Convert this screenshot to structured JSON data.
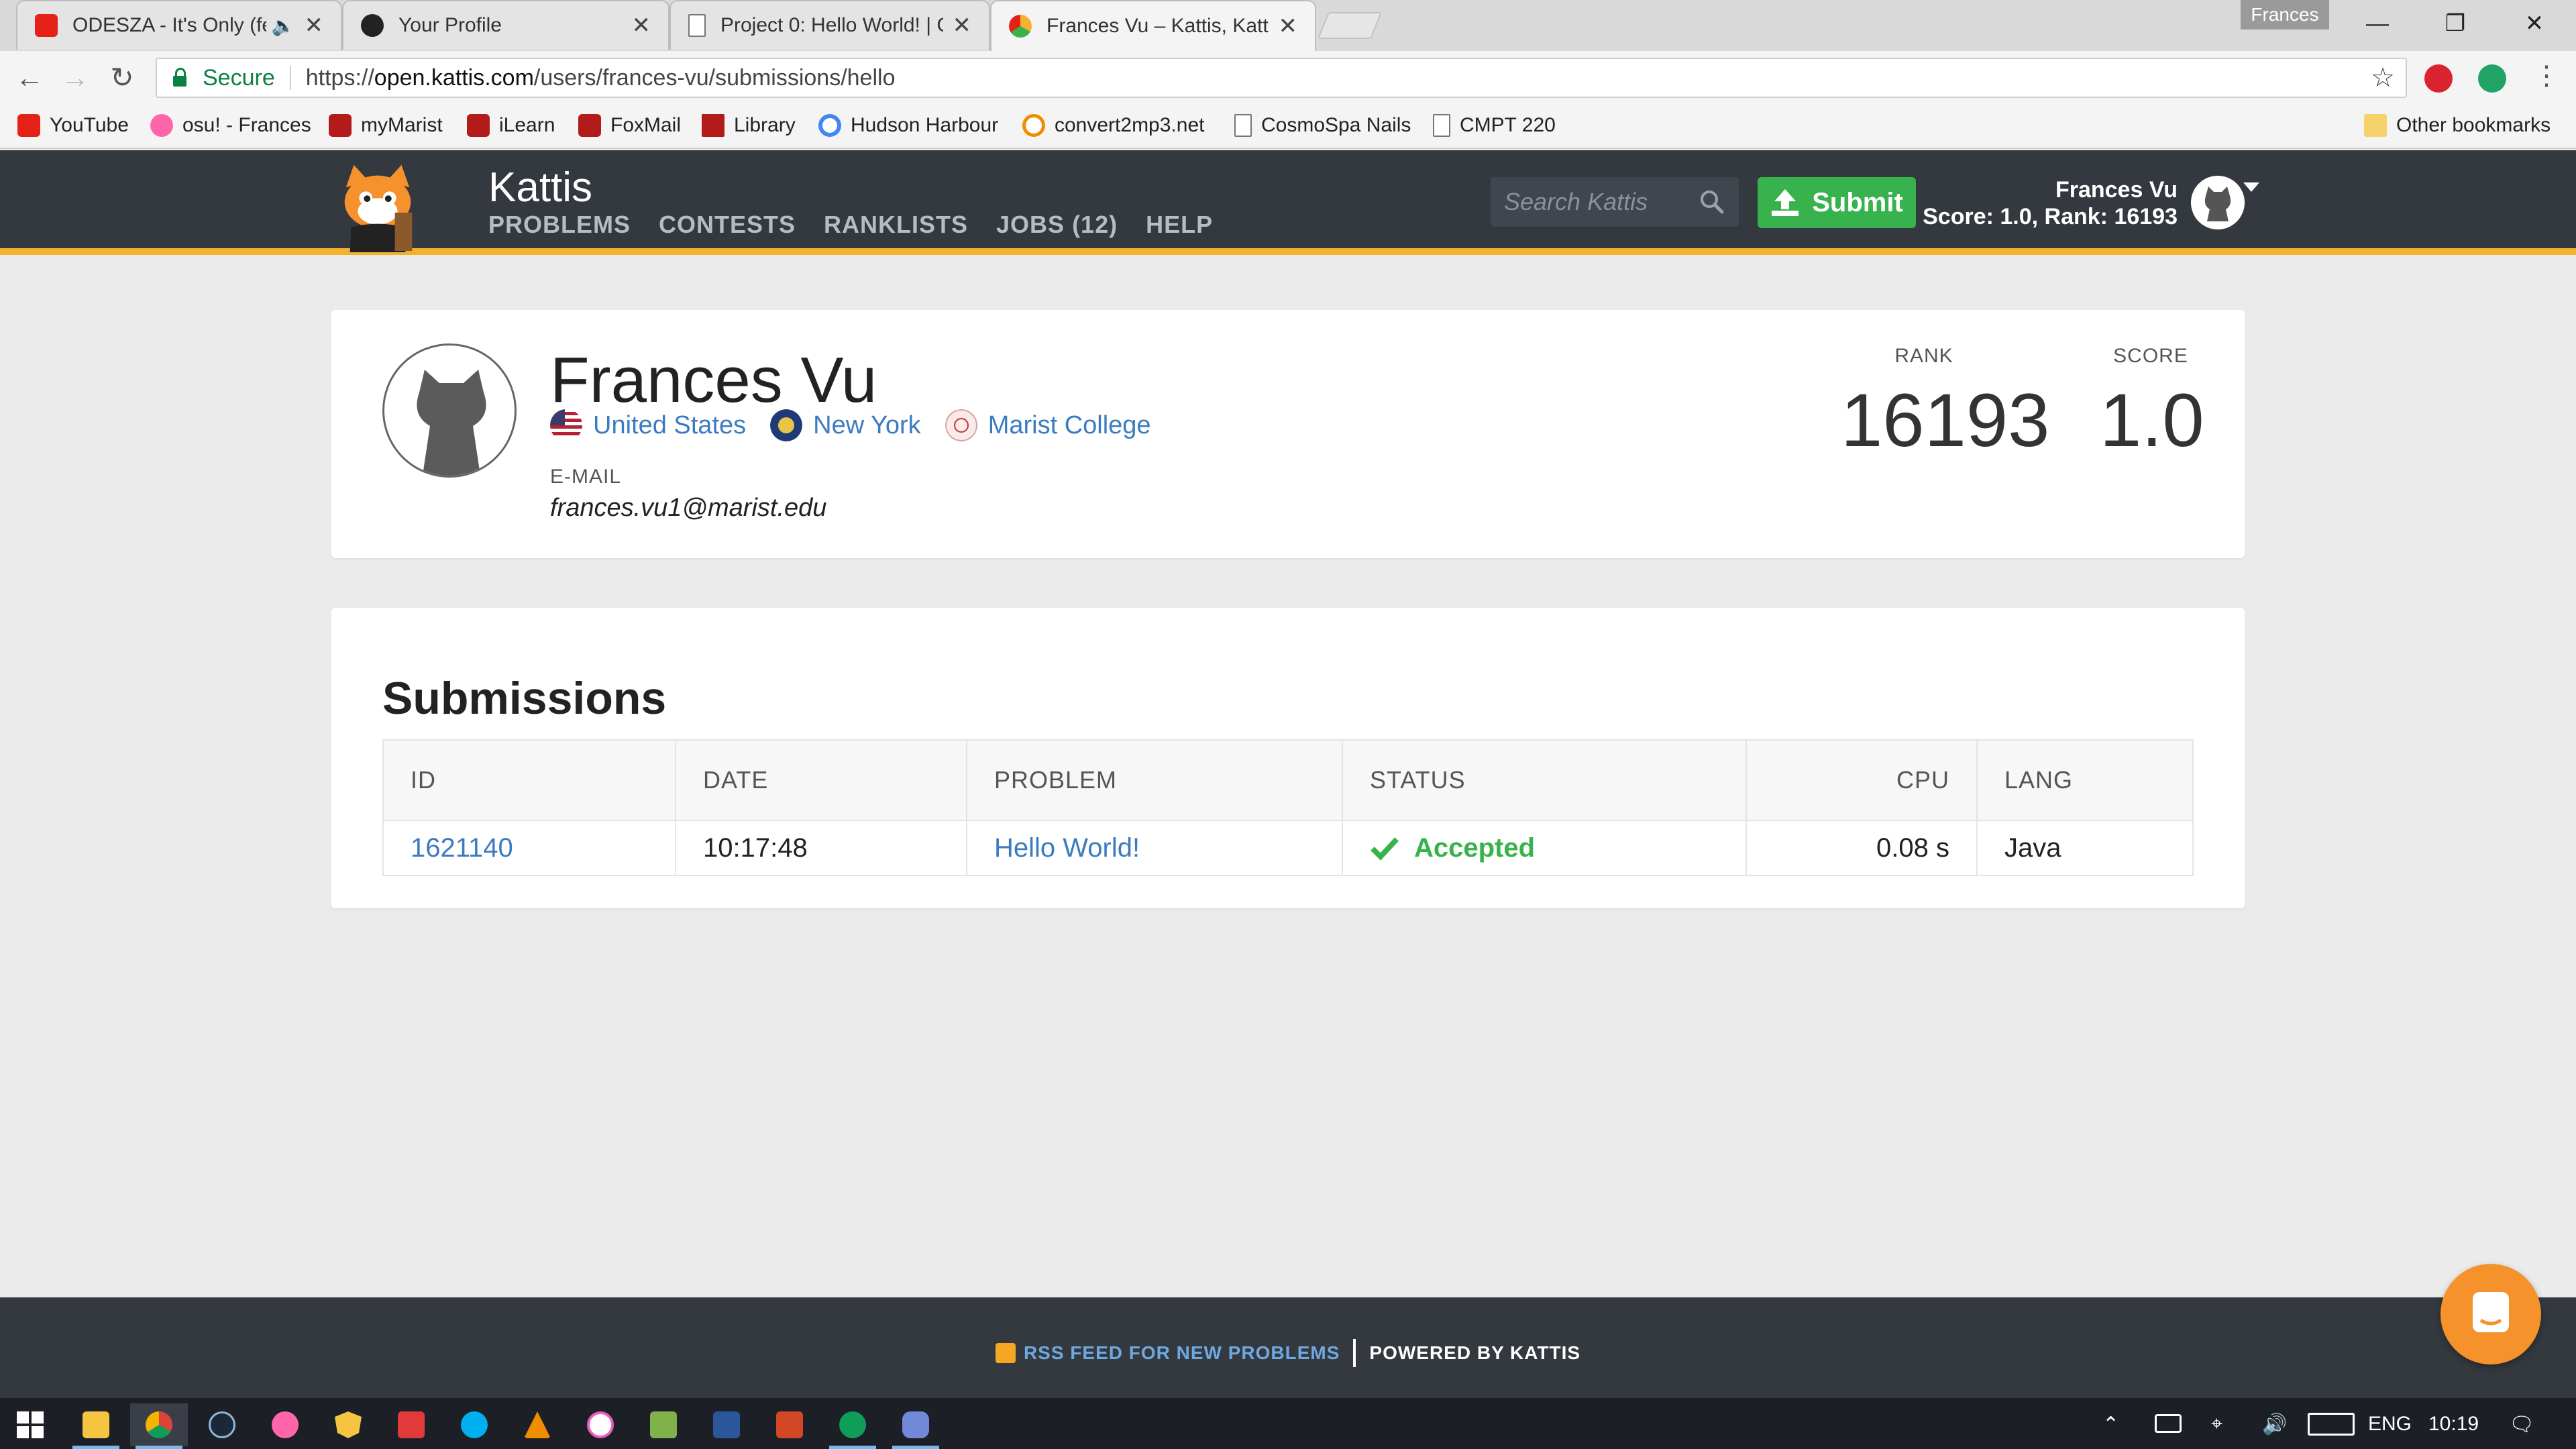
{
  "browser": {
    "tabs": [
      {
        "title": "ODESZA - It's Only (fe",
        "color": "#e62117"
      },
      {
        "title": "Your Profile",
        "color": "#222222"
      },
      {
        "title": "Project 0: Hello World! | C",
        "color": "#ffffff"
      },
      {
        "title": "Frances Vu – Kattis, Katti",
        "color": "#f5b32d"
      }
    ],
    "profile_badge": "Frances",
    "secure_label": "Secure",
    "url_scheme": "https://",
    "url_host": "open.kattis.com",
    "url_path": "/users/frances-vu/submissions/hello",
    "bookmarks": [
      {
        "label": "YouTube",
        "icon": "youtube-icon",
        "color": "#e62117"
      },
      {
        "label": "osu! - Frances",
        "icon": "osu-icon",
        "color": "#ff66aa"
      },
      {
        "label": "myMarist",
        "icon": "marist-fox-icon",
        "color": "#b31b1b"
      },
      {
        "label": "iLearn",
        "icon": "marist-fox-icon",
        "color": "#b31b1b"
      },
      {
        "label": "FoxMail",
        "icon": "marist-fox-icon",
        "color": "#b31b1b"
      },
      {
        "label": "Library",
        "icon": "jac-icon",
        "color": "#b31b1b"
      },
      {
        "label": "Hudson Harbour",
        "icon": "chrome-ring-icon",
        "color": "#4285f4"
      },
      {
        "label": "convert2mp3.net",
        "icon": "convert-icon",
        "color": "#f08c00"
      },
      {
        "label": "CosmoSpa Nails",
        "icon": "page-icon",
        "color": "#ffffff"
      },
      {
        "label": "CMPT 220",
        "icon": "page-icon",
        "color": "#ffffff"
      }
    ],
    "other_bookmarks": "Other bookmarks"
  },
  "kattis": {
    "brand": "Kattis",
    "nav": [
      "PROBLEMS",
      "CONTESTS",
      "RANKLISTS",
      "JOBS (12)",
      "HELP"
    ],
    "search_placeholder": "Search Kattis",
    "submit_label": "Submit",
    "user_name": "Frances Vu",
    "user_score_line": "Score: 1.0, Rank: 16193",
    "accent": "#f5b32d"
  },
  "profile": {
    "name": "Frances Vu",
    "country": "United States",
    "state": "New York",
    "college": "Marist College",
    "email_label": "E-MAIL",
    "email": "frances.vu1@marist.edu",
    "rank_label": "RANK",
    "rank": "16193",
    "score_label": "SCORE",
    "score": "1.0"
  },
  "submissions": {
    "title": "Submissions",
    "columns": [
      "ID",
      "DATE",
      "PROBLEM",
      "STATUS",
      "CPU",
      "LANG"
    ],
    "rows": [
      {
        "id": "1621140",
        "date": "10:17:48",
        "problem": "Hello World!",
        "status": "Accepted",
        "cpu": "0.08 s",
        "lang": "Java"
      }
    ],
    "accepted_color": "#37b24d"
  },
  "footer": {
    "rss_label": "RSS FEED FOR NEW PROBLEMS",
    "powered_label": "POWERED BY KATTIS"
  },
  "taskbar": {
    "apps": [
      "windows-start-icon",
      "file-explorer-icon",
      "chrome-icon",
      "steam-icon",
      "osu-icon",
      "shield-icon",
      "game-icon",
      "skype-icon",
      "vlc-icon",
      "itunes-icon",
      "notepad-icon",
      "word-icon",
      "powerpoint-icon",
      "hangouts-icon",
      "discord-icon"
    ],
    "language": "ENG",
    "time": "10:19"
  }
}
